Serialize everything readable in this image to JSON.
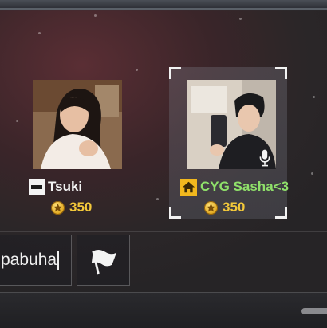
{
  "players": [
    {
      "name": "Tsuki",
      "points": "350",
      "badge": "flag-badge",
      "name_color": "#f4f4f4",
      "selected": false
    },
    {
      "name": "CYG Sasha<3",
      "points": "350",
      "badge": "home-badge",
      "name_color": "#8fe06a",
      "selected": true,
      "voice": "microphone-icon"
    }
  ],
  "chat": {
    "input_value": "pabuha"
  },
  "colors": {
    "points": "#f3c83a",
    "home_badge": "#f2b81e",
    "highlight_name": "#8fe06a"
  }
}
